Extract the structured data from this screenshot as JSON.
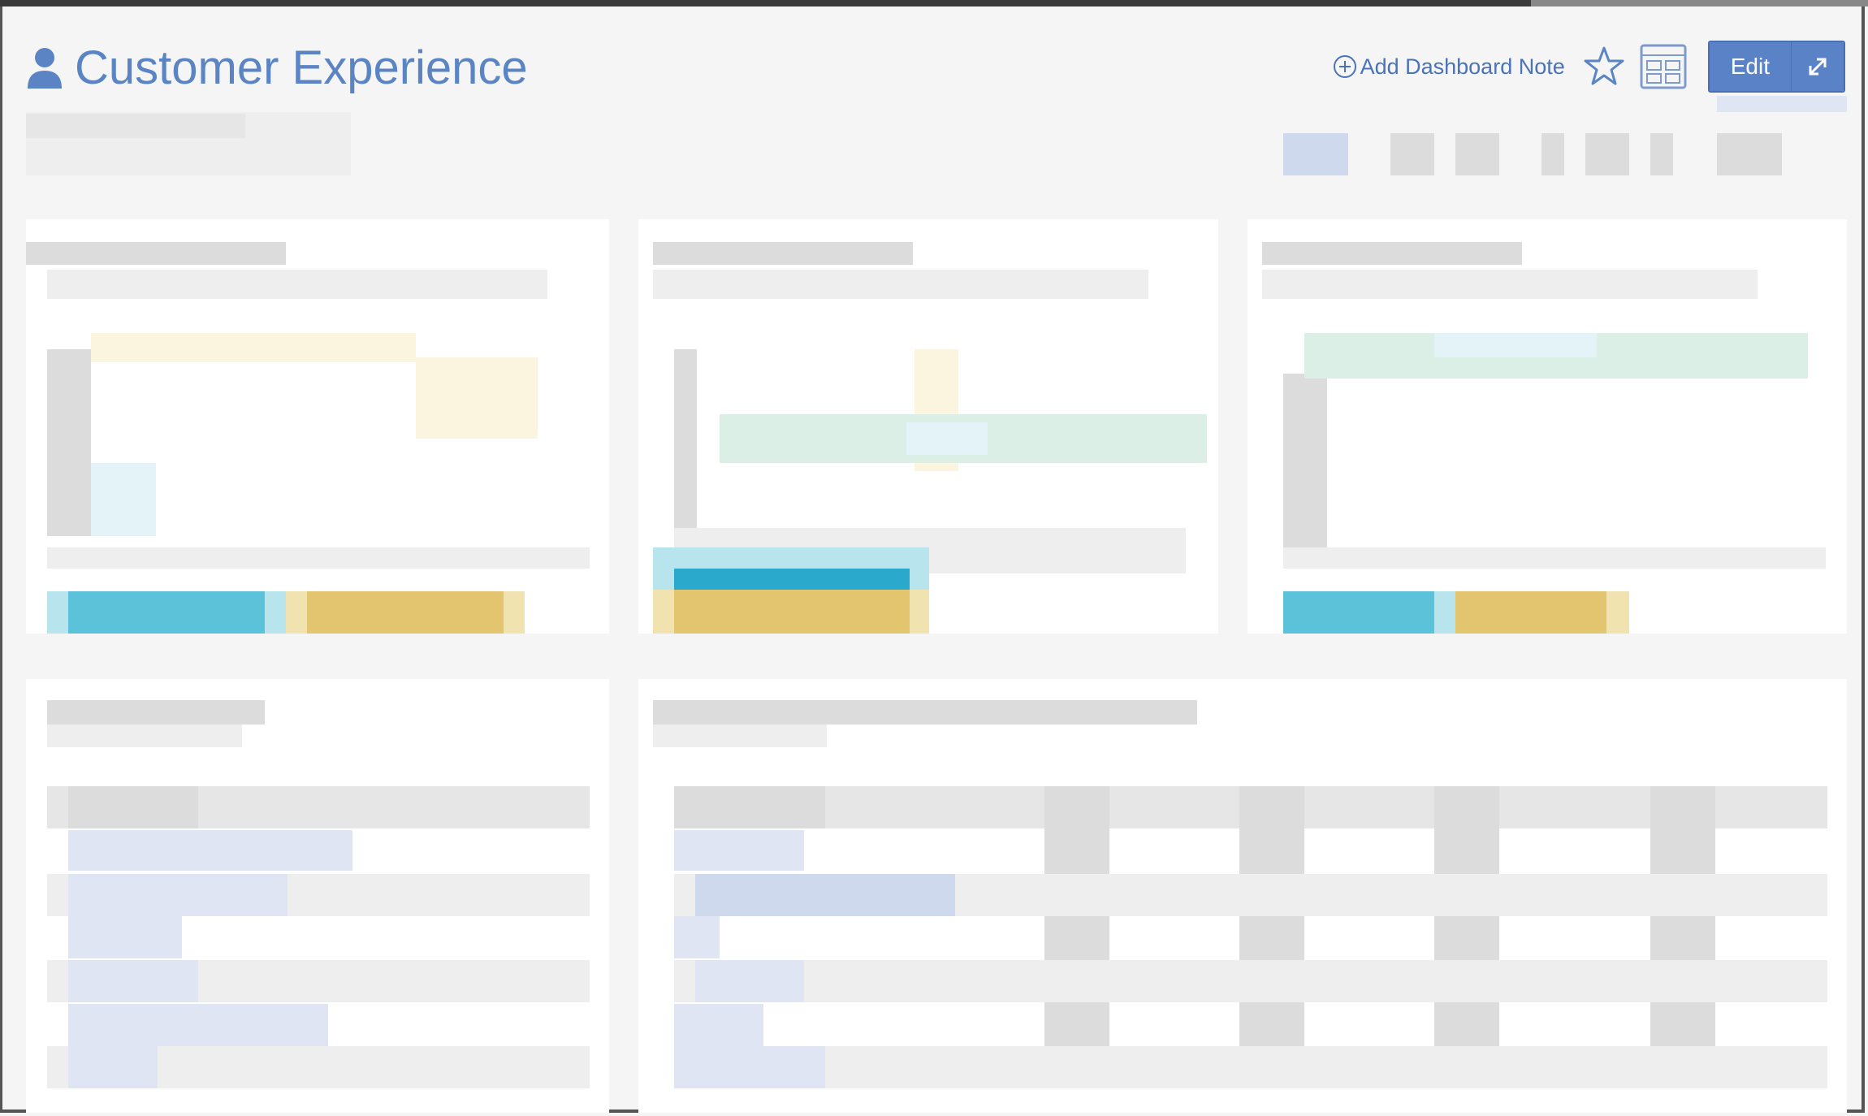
{
  "page": {
    "title": "Customer Experience"
  },
  "header": {
    "add_note_label": "Add Dashboard Note",
    "edit_label": "Edit"
  },
  "icons": {
    "user": "user-icon",
    "add": "plus-circle-icon",
    "favorite": "star-icon",
    "layout": "layout-grid-icon",
    "expand": "expand-icon"
  },
  "colors": {
    "accent": "#5b84c4",
    "button": "#5a82c6",
    "bar_cyan": "#5bc2d9",
    "bar_gold": "#e3c56f"
  }
}
